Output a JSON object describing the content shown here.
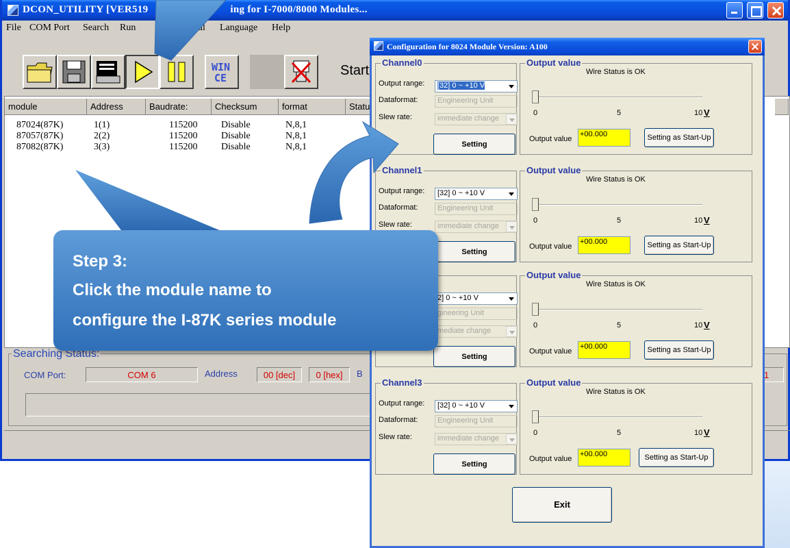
{
  "main_window": {
    "title": "DCON_UTILITY [VER519",
    "title_tail": "ing for I-7000/8000 Modules...",
    "menu": [
      "File",
      "COM Port",
      "Search",
      "Run",
      "minal",
      "Language",
      "Help"
    ],
    "toolbar": {
      "icons": [
        "folder-icon",
        "save-icon",
        "terminal-icon",
        "play-icon",
        "pause-icon",
        "wince-icon",
        "blank-icon",
        "disconnect-icon"
      ],
      "wince_label": "WIN\nCE",
      "start_label": "Start"
    },
    "grid": {
      "columns": [
        "module",
        "Address",
        "Baudrate:",
        "Checksum",
        "format",
        "Statu"
      ],
      "rows": [
        {
          "module": "87024(87K)",
          "address": "1(1)",
          "baudrate": "115200",
          "checksum": "Disable",
          "format": "N,8,1"
        },
        {
          "module": "87057(87K)",
          "address": "2(2)",
          "baudrate": "115200",
          "checksum": "Disable",
          "format": "N,8,1"
        },
        {
          "module": "87082(87K)",
          "address": "3(3)",
          "baudrate": "115200",
          "checksum": "Disable",
          "format": "N,8,1"
        }
      ]
    },
    "status": {
      "title": "Searching Status:",
      "com_port_label": "COM Port:",
      "com_port_value": "COM 6",
      "address_label": "Address",
      "address_dec": "00 [dec]",
      "address_hex": "0 [hex]",
      "b_label": "B",
      "right_value": "1"
    }
  },
  "config_dialog": {
    "title": "Configuration for 8024 Module Version: A100",
    "channels": [
      {
        "name": "Channel0",
        "output_range_label": "Output range:",
        "output_range": "[32] 0 ~ +10 V",
        "dataformat_label": "Dataformat:",
        "dataformat": "Engineering Unit",
        "slew_label": "Slew rate:",
        "slew": "immediate change",
        "setting": "Setting",
        "output_title": "Output value",
        "wire_status": "Wire Status is OK",
        "tick0": "0",
        "tick5": "5",
        "tick10": "10",
        "unit": "V",
        "output_value_label": "Output value",
        "output_value": "+00.000",
        "startup": "Setting as Start-Up"
      },
      {
        "name": "Channel1",
        "output_range_label": "Output range:",
        "output_range": "[32] 0 ~ +10 V",
        "dataformat_label": "Dataformat:",
        "dataformat": "Engineering Unit",
        "slew_label": "Slew rate:",
        "slew": "immediate change",
        "setting": "Setting",
        "output_title": "Output value",
        "wire_status": "Wire Status is OK",
        "tick0": "0",
        "tick5": "5",
        "tick10": "10",
        "unit": "V",
        "output_value_label": "Output value",
        "output_value": "+00.000",
        "startup": "Setting as Start-Up"
      },
      {
        "name": "",
        "output_range_label": "",
        "output_range": "2] 0 ~ +10 V",
        "dataformat_label": "",
        "dataformat": "gineering Unit",
        "slew_label": "",
        "slew": "mediate change",
        "setting": "Setting",
        "output_title": "Output value",
        "wire_status": "Wire Status is OK",
        "tick0": "0",
        "tick5": "5",
        "tick10": "10",
        "unit": "V",
        "output_value_label": "Output value",
        "output_value": "+00.000",
        "startup": "Setting as Start-Up"
      },
      {
        "name": "Channel3",
        "output_range_label": "Output range:",
        "output_range": "[32] 0 ~ +10 V",
        "dataformat_label": "Dataformat:",
        "dataformat": "Engineering Unit",
        "slew_label": "Slew rate:",
        "slew": "immediate change",
        "setting": "Setting",
        "output_title": "Output value",
        "wire_status": "Wire Status is OK",
        "tick0": "0",
        "tick5": "5",
        "tick10": "10",
        "unit": "V",
        "output_value_label": "Output value",
        "output_value": "+00.000",
        "startup": "Setting as Start-Up"
      }
    ],
    "exit_label": "Exit"
  },
  "callout": {
    "line1": "Step 3:",
    "line2": "Click the module name to",
    "line3": "configure the I-87K series module"
  },
  "colors": {
    "titlebar": "#0a4ad8",
    "callout": "#3a7cc4",
    "output_value_bg": "#ffff00",
    "status_value": "#d20000"
  }
}
